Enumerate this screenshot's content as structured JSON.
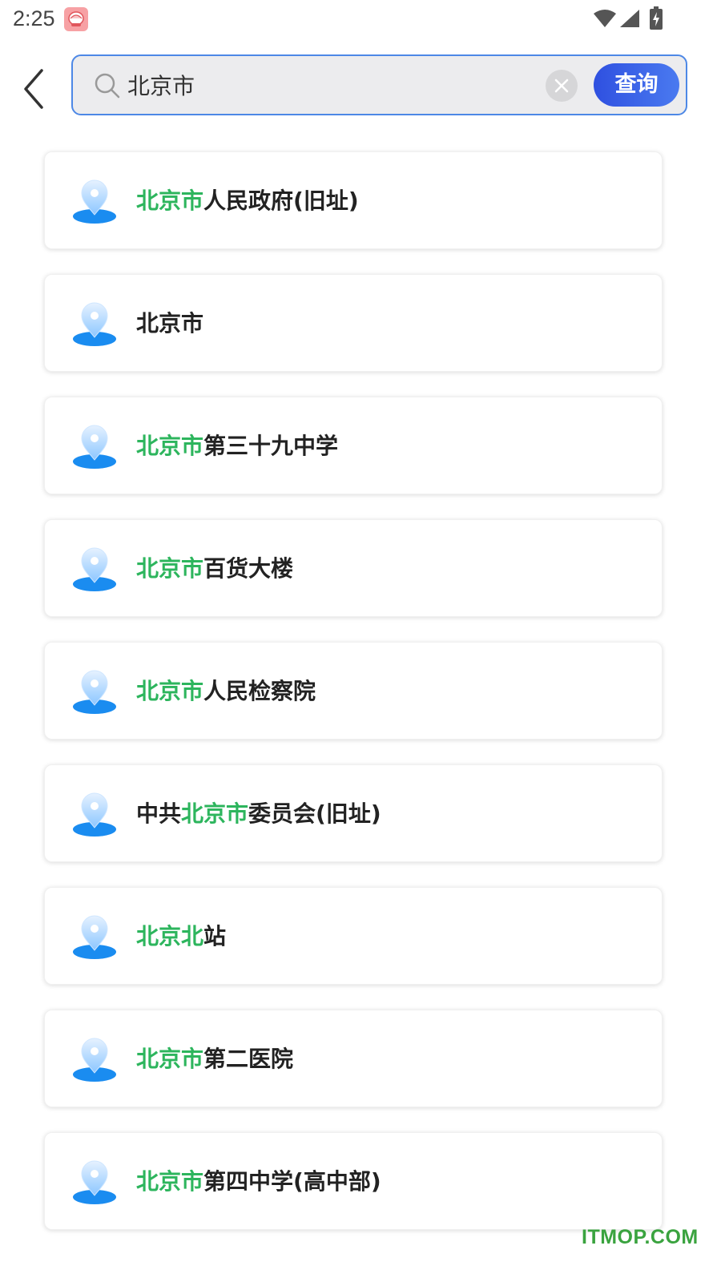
{
  "status_bar": {
    "time": "2:25"
  },
  "search": {
    "value": "北京市",
    "button_label": "查询"
  },
  "results": [
    {
      "highlight": "北京市",
      "before": "",
      "after": "人民政府(旧址)"
    },
    {
      "highlight": "",
      "before": "北京市",
      "after": ""
    },
    {
      "highlight": "北京市",
      "before": "",
      "after": "第三十九中学"
    },
    {
      "highlight": "北京市",
      "before": "",
      "after": "百货大楼"
    },
    {
      "highlight": "北京市",
      "before": "",
      "after": "人民检察院"
    },
    {
      "highlight": "北京市",
      "before": "中共",
      "after": "委员会(旧址)"
    },
    {
      "highlight": "北京北",
      "before": "",
      "after": "站"
    },
    {
      "highlight": "北京市",
      "before": "",
      "after": "第二医院"
    },
    {
      "highlight": "北京市",
      "before": "",
      "after": "第四中学(高中部)"
    }
  ],
  "watermark": "ITMOP.COM",
  "colors": {
    "accent_blue": "#2f50e0",
    "highlight_green": "#2db55d",
    "search_border": "#4d88e6"
  },
  "icons": {
    "back": "chevron-left-icon",
    "search": "search-icon",
    "clear": "clear-icon",
    "pin": "location-pin-icon"
  }
}
